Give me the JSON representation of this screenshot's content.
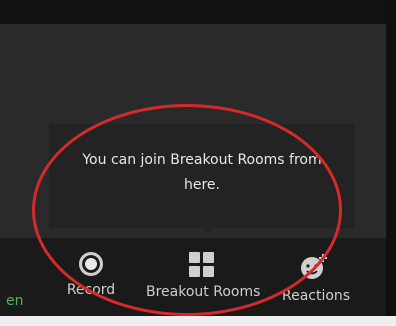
{
  "tooltip": {
    "message_line1": "You can join Breakout Rooms from",
    "message_line2": "here."
  },
  "toolbar": {
    "partial_label": "en",
    "items": [
      {
        "label": "Record",
        "icon": "record-icon"
      },
      {
        "label": "Breakout Rooms",
        "icon": "breakout-rooms-icon"
      },
      {
        "label": "Reactions",
        "icon": "reactions-icon"
      }
    ]
  },
  "colors": {
    "annotation_ellipse": "#d52a2a",
    "toolbar_bg": "#1a1a1a",
    "active_green": "#4cb35a"
  }
}
